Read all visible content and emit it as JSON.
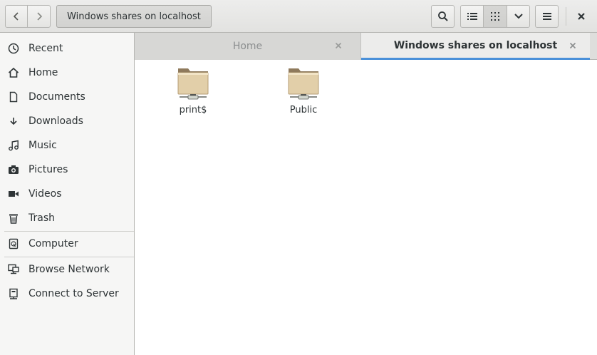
{
  "header": {
    "path_label": "Windows shares on localhost",
    "back_icon": "chevron-left-icon",
    "forward_icon": "chevron-right-icon",
    "search_icon": "search-icon",
    "list_view_icon": "list-view-icon",
    "grid_view_icon": "grid-view-icon",
    "view_options_icon": "chevron-down-icon",
    "menu_icon": "hamburger-menu-icon",
    "close_icon": "close-icon"
  },
  "sidebar": {
    "items": [
      {
        "label": "Recent",
        "icon": "recent-icon"
      },
      {
        "label": "Home",
        "icon": "home-icon"
      },
      {
        "label": "Documents",
        "icon": "documents-icon"
      },
      {
        "label": "Downloads",
        "icon": "downloads-icon"
      },
      {
        "label": "Music",
        "icon": "music-icon"
      },
      {
        "label": "Pictures",
        "icon": "pictures-icon"
      },
      {
        "label": "Videos",
        "icon": "videos-icon"
      },
      {
        "label": "Trash",
        "icon": "trash-icon"
      },
      {
        "label": "Computer",
        "icon": "computer-icon"
      },
      {
        "label": "Browse Network",
        "icon": "network-icon"
      },
      {
        "label": "Connect to Server",
        "icon": "server-icon"
      }
    ]
  },
  "tabs": [
    {
      "label": "Home",
      "active": false
    },
    {
      "label": "Windows shares on localhost",
      "active": true
    }
  ],
  "files": [
    {
      "name": "print$",
      "icon": "network-folder-icon"
    },
    {
      "name": "Public",
      "icon": "network-folder-icon"
    }
  ],
  "colors": {
    "accent": "#4a90d9",
    "folder": "#e2cfa9",
    "folder_tab": "#8f7a5c"
  }
}
